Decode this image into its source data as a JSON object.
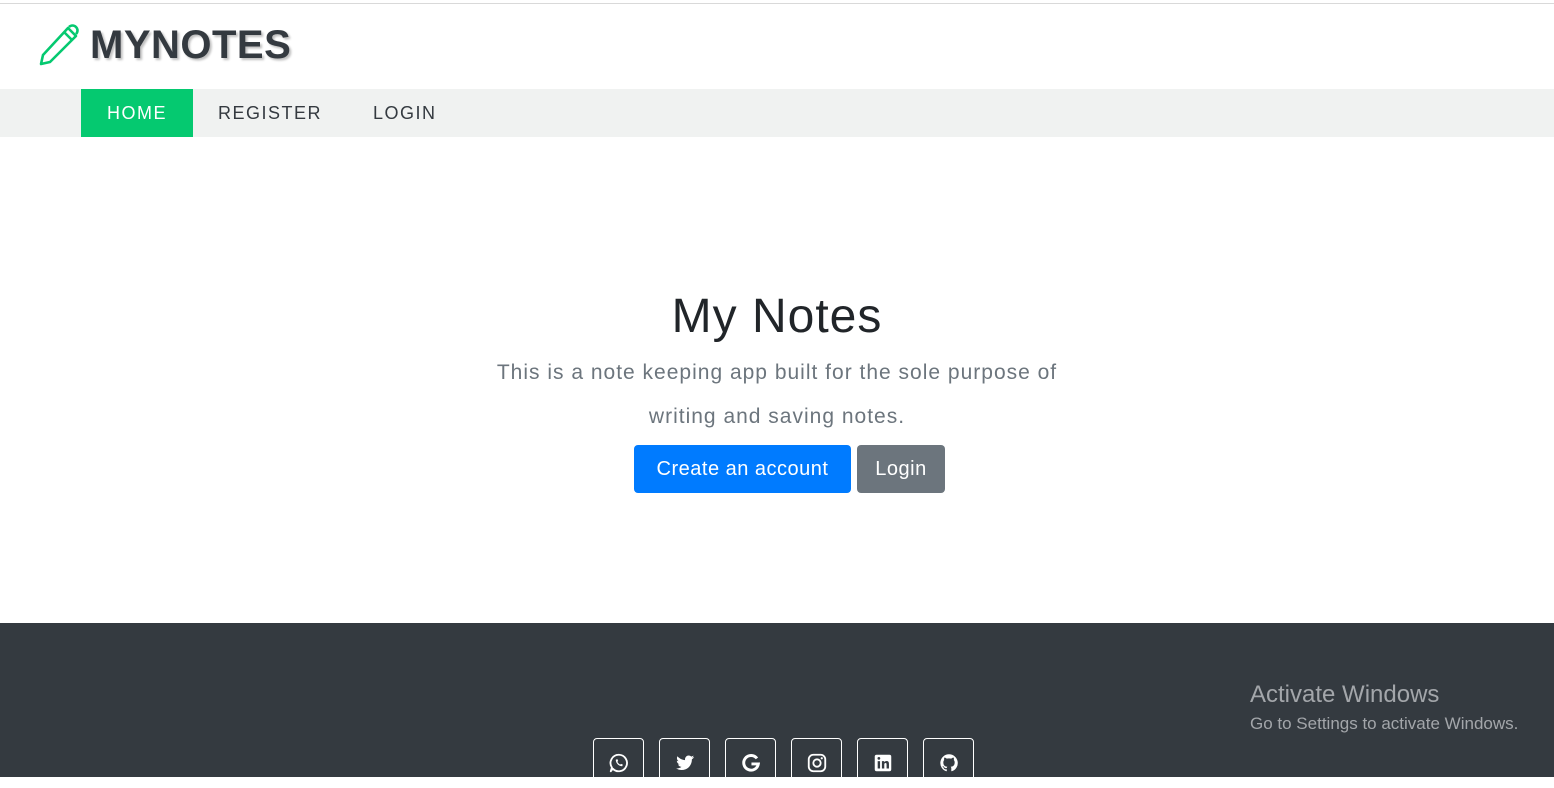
{
  "brand": {
    "name": "MYNOTES",
    "icon": "pencil-icon",
    "icon_color": "#05c970"
  },
  "nav": {
    "items": [
      {
        "label": "HOME",
        "active": true
      },
      {
        "label": "REGISTER",
        "active": false
      },
      {
        "label": "LOGIN",
        "active": false
      }
    ],
    "active_color": "#05c970"
  },
  "hero": {
    "title": "My Notes",
    "description": "This is a note keeping app built for the sole purpose of writing and saving notes.",
    "create_account_label": "Create an account",
    "login_label": "Login"
  },
  "footer": {
    "social_icons": [
      "whatsapp-icon",
      "twitter-icon",
      "google-icon",
      "instagram-icon",
      "linkedin-icon",
      "github-icon"
    ]
  },
  "watermark": {
    "title": "Activate Windows",
    "subtitle": "Go to Settings to activate Windows."
  },
  "colors": {
    "primary": "#007bff",
    "secondary": "#6c757d",
    "footer_bg": "#343a40",
    "navbar_bg": "#f0f2f1"
  }
}
